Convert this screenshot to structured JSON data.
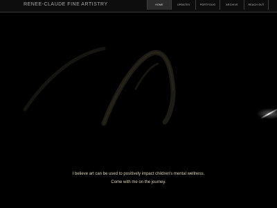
{
  "header": {
    "brand": "RENEE-CLAUDE FINE ARTISTRY"
  },
  "nav": {
    "items": [
      {
        "label": "HOME",
        "active": true
      },
      {
        "label": "UPDATES",
        "active": false
      },
      {
        "label": "PORTFOLIO",
        "active": false
      },
      {
        "label": "ARCHIVE",
        "active": false
      },
      {
        "label": "REACH OUT",
        "active": false
      }
    ]
  },
  "hero": {
    "line1": "I believe art can be used to positively impact children's mental wellness.",
    "line2": "Come with me on the journey."
  },
  "colors": {
    "background": "#000000",
    "accent_text": "#d9d3b8",
    "nav_active_bg": "#2b2b2b"
  }
}
